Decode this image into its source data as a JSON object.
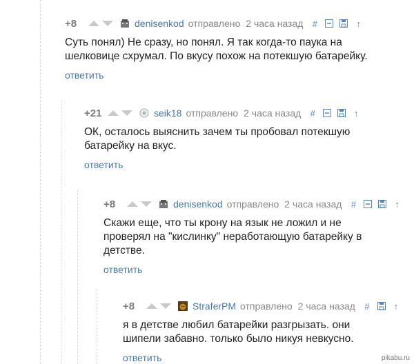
{
  "comments": [
    {
      "rating": "+8",
      "username": "denisenkod",
      "sent": "отправлено",
      "time": "2 часа назад",
      "text": "Суть понял) Не сразу, но понял. Я так когда-то паука на шелковице схрумал. По вкусу похож на потекшую батарейку.",
      "reply": "ответить",
      "avatar": "robot-avatar"
    },
    {
      "rating": "+21",
      "username": "seik18",
      "sent": "отправлено",
      "time": "2 часа назад",
      "text": "ОК, осталось выяснить зачем ты пробовал потекшую батарейку на вкус.",
      "reply": "ответить",
      "avatar": "flower-avatar"
    },
    {
      "rating": "+8",
      "username": "denisenkod",
      "sent": "отправлено",
      "time": "2 часа назад",
      "text": "Скажи еще, что ты крону на язык не ложил и не проверял на \"кислинку\" неработающую батарейку в детстве.",
      "reply": "ответить",
      "avatar": "robot-avatar"
    },
    {
      "rating": "+8",
      "username": "StraferPM",
      "sent": "отправлено",
      "time": "2 часа назад",
      "text": "я в детстве любил батарейки разгрызать. они шипели забавно. только было никуя невкусно.",
      "reply": "ответить",
      "avatar": "bear-avatar"
    }
  ],
  "toolbar_icons": [
    "hash-icon",
    "minus-box-icon",
    "save-icon",
    "arrow-up-icon"
  ],
  "colors": {
    "link": "#4a77a8",
    "muted": "#888888",
    "vote": "#c9c9c9",
    "rating": "#7a7a7a"
  },
  "watermark": "pikabu.ru"
}
